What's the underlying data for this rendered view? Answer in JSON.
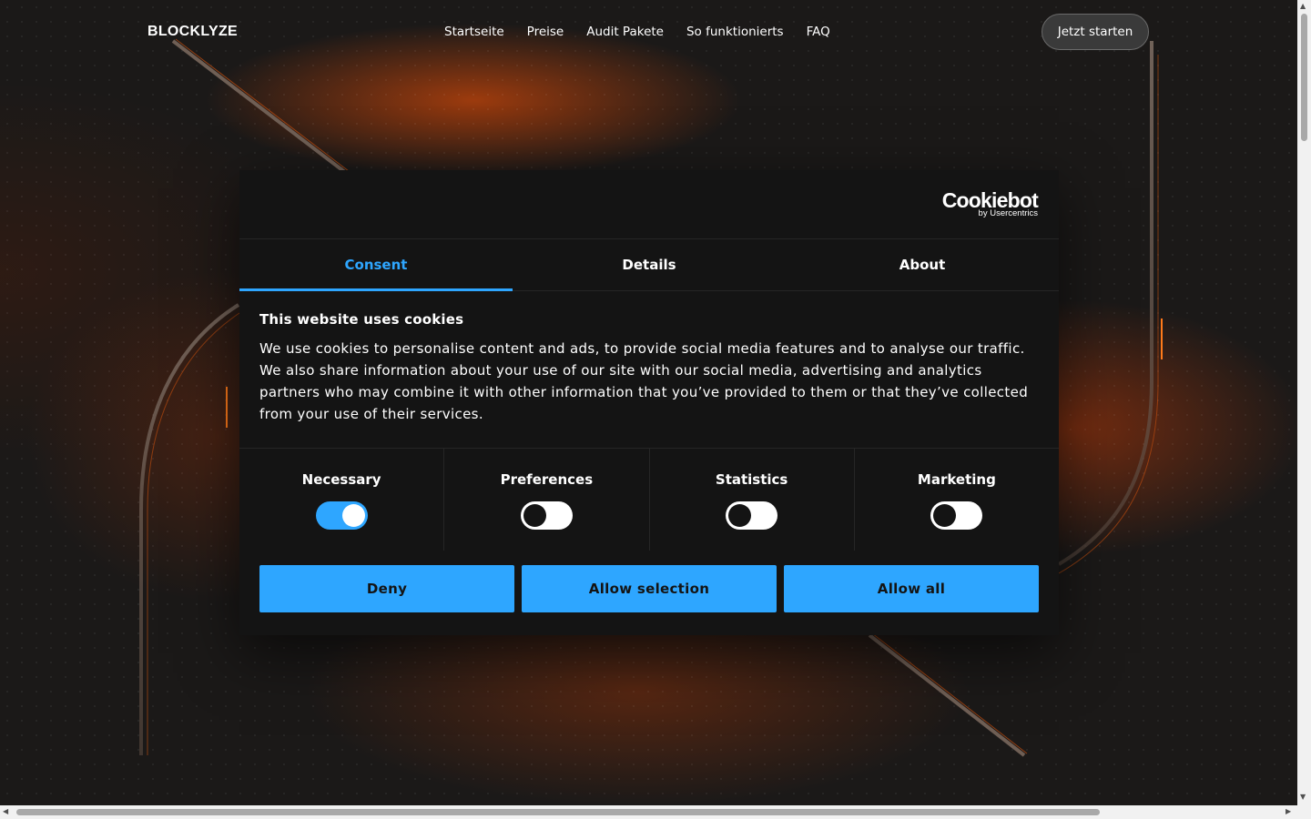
{
  "header": {
    "brand": "BLOCKLYZE",
    "nav": [
      "Startseite",
      "Preise",
      "Audit Pakete",
      "So funktionierts",
      "FAQ"
    ],
    "cta_label": "Jetzt starten"
  },
  "dialog": {
    "logo_main": "Cookiebot",
    "logo_sub": "by Usercentrics",
    "tabs": [
      "Consent",
      "Details",
      "About"
    ],
    "active_tab": "Consent",
    "title": "This website uses cookies",
    "text": "We use cookies to personalise content and ads, to provide social media features and to analyse our traffic. We also share information about your use of our site with our social media, advertising and analytics partners who may combine it with other information that you’ve provided to them or that they’ve collected from your use of their services.",
    "toggles": [
      {
        "label": "Necessary",
        "on": true
      },
      {
        "label": "Preferences",
        "on": false
      },
      {
        "label": "Statistics",
        "on": false
      },
      {
        "label": "Marketing",
        "on": false
      }
    ],
    "buttons": {
      "deny": "Deny",
      "allow_selection": "Allow selection",
      "allow_all": "Allow all"
    }
  },
  "colors": {
    "accent": "#2ea6ff",
    "dialog_bg": "#141414",
    "glow": "#c8460a"
  }
}
